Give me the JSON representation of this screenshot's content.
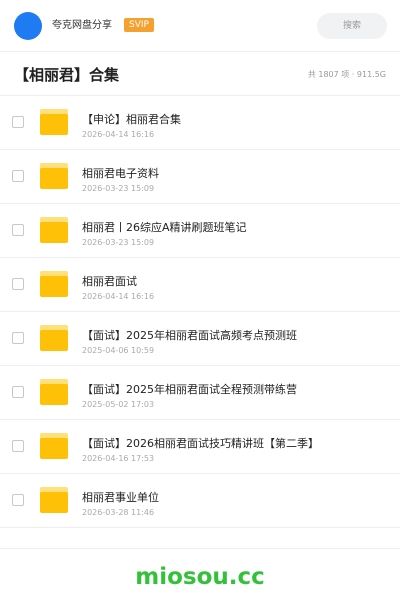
{
  "header": {
    "share_name": "夸克网盘分享",
    "vip_label": "SVIP",
    "search_placeholder": "搜索"
  },
  "page": {
    "title": "【相丽君】合集",
    "stats": "共 1807 项 · 911.5G"
  },
  "files": [
    {
      "name": "【申论】相丽君合集",
      "date": "2026-04-14 16:16"
    },
    {
      "name": "相丽君电子资料",
      "date": "2026-03-23 15:09"
    },
    {
      "name": "相丽君丨26综应A精讲刷题班笔记",
      "date": "2026-03-23 15:09"
    },
    {
      "name": "相丽君面试",
      "date": "2026-04-14 16:16"
    },
    {
      "name": "【面试】2025年相丽君面试高频考点预测班",
      "date": "2025-04-06 10:59"
    },
    {
      "name": "【面试】2025年相丽君面试全程预测带练营",
      "date": "2025-05-02 17:03"
    },
    {
      "name": "【面试】2026相丽君面试技巧精讲班【第二季】",
      "date": "2026-04-16 17:53"
    },
    {
      "name": "相丽君事业单位",
      "date": "2026-03-28 11:46"
    }
  ],
  "footer": {
    "watermark": "miosou.cc"
  },
  "colors": {
    "avatar": "#1e7bf2",
    "vip_badge": "#f5a12f",
    "folder": "#ffc107",
    "watermark": "#33c13a"
  }
}
